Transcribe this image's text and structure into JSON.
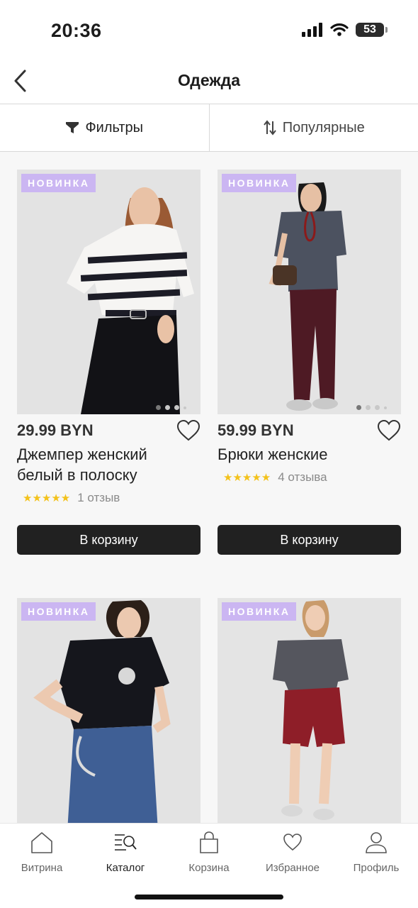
{
  "status": {
    "time": "20:36",
    "battery": "53"
  },
  "header": {
    "title": "Одежда"
  },
  "filters": {
    "filter_label": "Фильтры",
    "sort_label": "Популярные"
  },
  "products": [
    {
      "badge": "НОВИНКА",
      "price": "29.99 BYN",
      "name_line1": "Джемпер женский",
      "name_line2": "белый в полоску",
      "stars": "★★★★★",
      "reviews": "1 отзыв",
      "cart_label": "В корзину"
    },
    {
      "badge": "НОВИНКА",
      "price": "59.99 BYN",
      "name_line1": "Брюки женские",
      "stars": "★★★★★",
      "reviews": "4 отзыва",
      "cart_label": "В корзину"
    },
    {
      "badge": "НОВИНКА"
    },
    {
      "badge": "НОВИНКА"
    }
  ],
  "tabbar": [
    {
      "label": "Витрина",
      "icon": "home-icon"
    },
    {
      "label": "Каталог",
      "icon": "catalog-search-icon",
      "active": true
    },
    {
      "label": "Корзина",
      "icon": "bag-icon"
    },
    {
      "label": "Избранное",
      "icon": "heart-icon"
    },
    {
      "label": "Профиль",
      "icon": "profile-icon"
    }
  ],
  "colors": {
    "badge": "#cbb6f2",
    "button": "#212121",
    "stars": "#f3c21b",
    "background": "#f7f7f7"
  }
}
